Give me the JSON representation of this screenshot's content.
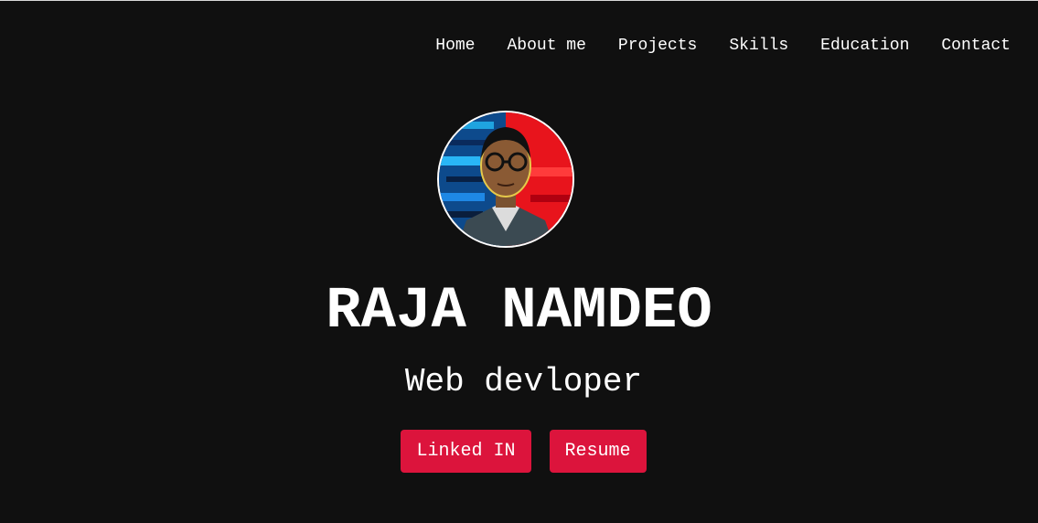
{
  "nav": {
    "items": [
      {
        "label": "Home"
      },
      {
        "label": "About me"
      },
      {
        "label": "Projects"
      },
      {
        "label": "Skills"
      },
      {
        "label": "Education"
      },
      {
        "label": "Contact"
      }
    ]
  },
  "hero": {
    "name": "RAJA NAMDEO",
    "role": "Web devloper",
    "buttons": {
      "linkedin_label": "Linked IN",
      "resume_label": "Resume"
    }
  },
  "colors": {
    "background": "#101010",
    "accent": "#dc143c",
    "text": "#ffffff"
  }
}
